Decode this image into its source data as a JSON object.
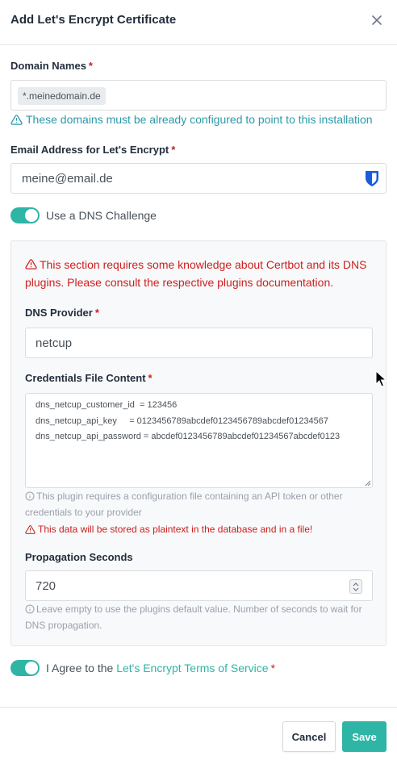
{
  "dialog": {
    "title": "Add Let's Encrypt Certificate",
    "close_icon": "close-icon"
  },
  "domain_names": {
    "label": "Domain Names",
    "required_mark": "*",
    "tag": "*.meinedomain.de",
    "hint": "These domains must be already configured to point to this installation",
    "hint_icon": "alert-triangle-icon"
  },
  "email": {
    "label": "Email Address for Let's Encrypt",
    "required_mark": "*",
    "value": "meine@email.de",
    "password_manager_icon": "bitwarden-shield-icon"
  },
  "dns_challenge": {
    "label": "Use a DNS Challenge",
    "enabled": true
  },
  "dns_section": {
    "warning": "This section requires some knowledge about Certbot and its DNS plugins. Please consult the respective plugins documentation.",
    "provider": {
      "label": "DNS Provider",
      "required_mark": "*",
      "value": "netcup"
    },
    "credentials": {
      "label": "Credentials File Content",
      "required_mark": "*",
      "lines": [
        "dns_netcup_customer_id  = 123456",
        "dns_netcup_api_key     = 0123456789abcdef0123456789abcdef01234567",
        "dns_netcup_api_password = abcdef0123456789abcdef01234567abcdef0123"
      ],
      "info": "This plugin requires a configuration file containing an API token or other credentials to your provider",
      "plaintext_warning": "This data will be stored as plaintext in the database and in a file!"
    },
    "propagation": {
      "label": "Propagation Seconds",
      "value": "720",
      "info": "Leave empty to use the plugins default value. Number of seconds to wait for DNS propagation."
    }
  },
  "agree": {
    "prefix": "I Agree to the",
    "link": "Let's Encrypt Terms of Service",
    "required_mark": "*",
    "enabled": true
  },
  "footer": {
    "cancel_label": "Cancel",
    "save_label": "Save"
  },
  "colors": {
    "accent": "#2fb5a6",
    "danger": "#cd201f",
    "hint": "#2a9aa8",
    "panel_bg": "#f8f9fa"
  }
}
